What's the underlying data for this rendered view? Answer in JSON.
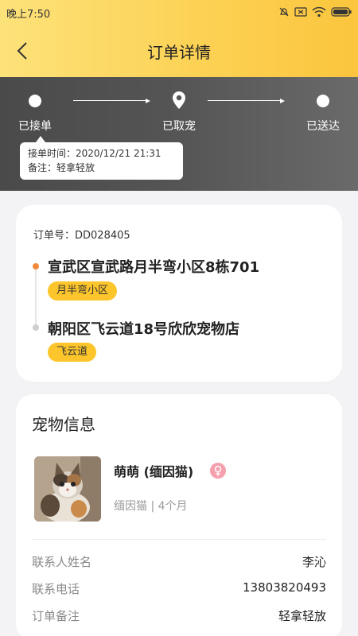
{
  "status_bar": {
    "time": "晚上7:50"
  },
  "header": {
    "title": "订单详情"
  },
  "progress": {
    "steps": [
      {
        "label": "已接单"
      },
      {
        "label": "已取宠"
      },
      {
        "label": "已送达"
      }
    ],
    "tooltip": {
      "line1": "接单时间：2020/12/21 21:31",
      "line2": "备注：轻拿轻放"
    }
  },
  "order": {
    "order_no": "订单号：DD028405",
    "pickup": {
      "address": "宣武区宣武路月半弯小区8栋701",
      "tag": "月半弯小区"
    },
    "dropoff": {
      "address": "朝阳区飞云道18号欣欣宠物店",
      "tag": "飞云道"
    }
  },
  "pet": {
    "section_title": "宠物信息",
    "name": "萌萌 (缅因猫)",
    "meta": "缅因猫 | 4个月",
    "info": [
      {
        "label": "联系人姓名",
        "value": "李沁"
      },
      {
        "label": "联系电话",
        "value": "13803820493"
      },
      {
        "label": "订单备注",
        "value": "轻拿轻放"
      }
    ]
  },
  "colors": {
    "accent": "#fcc52b",
    "pickup_dot": "#f08a3c",
    "dropoff_dot": "#cfcfcf",
    "gender": "#f5a0ad"
  },
  "icons": [
    "back-arrow-icon",
    "location-pin-icon",
    "female-icon",
    "mute-icon",
    "sim-icon",
    "wifi-icon",
    "battery-icon"
  ]
}
